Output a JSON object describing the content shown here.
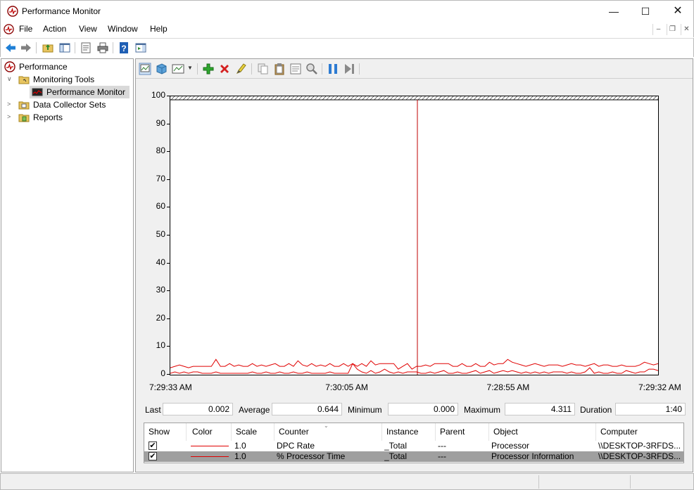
{
  "window": {
    "title": "Performance Monitor"
  },
  "menu": [
    "File",
    "Action",
    "View",
    "Window",
    "Help"
  ],
  "tree": {
    "items": [
      {
        "label": "Performance",
        "indent": 0,
        "icon": "perfmon-icon"
      },
      {
        "label": "Monitoring Tools",
        "indent": 1,
        "icon": "folder-icon"
      },
      {
        "label": "Performance Monitor",
        "indent": 2,
        "icon": "monitor-chart-icon"
      },
      {
        "label": "Data Collector Sets",
        "indent": 1,
        "icon": "folder-icon"
      },
      {
        "label": "Reports",
        "indent": 1,
        "icon": "folder-icon"
      }
    ]
  },
  "graph": {
    "x_labels": [
      "7:29:33 AM",
      "7:30:05 AM",
      "7:28:55 AM",
      "7:29:32 AM"
    ],
    "y_labels": [
      "100",
      "90",
      "80",
      "70",
      "60",
      "50",
      "40",
      "30",
      "20",
      "10",
      "0"
    ]
  },
  "stats": {
    "last_label": "Last",
    "last_value": "0.002",
    "avg_label": "Average",
    "avg_value": "0.644",
    "min_label": "Minimum",
    "min_value": "0.000",
    "max_label": "Maximum",
    "max_value": "4.311",
    "dur_label": "Duration",
    "dur_value": "1:40"
  },
  "counters": {
    "headers": [
      "Show",
      "Color",
      "Scale",
      "Counter",
      "Instance",
      "Parent",
      "Object",
      "Computer"
    ],
    "rows": [
      {
        "show": "✔",
        "scale": "1.0",
        "counter": "DPC Rate",
        "instance": "_Total",
        "parent": "---",
        "object": "Processor",
        "computer": "\\\\DESKTOP-3RFDS..."
      },
      {
        "show": "✔",
        "scale": "1.0",
        "counter": "% Processor Time",
        "instance": "_Total",
        "parent": "---",
        "object": "Processor Information",
        "computer": "\\\\DESKTOP-3RFDS..."
      }
    ]
  },
  "chart_data": {
    "type": "line",
    "ylim": [
      0,
      100
    ],
    "x_tick_labels": [
      "7:29:33 AM",
      "7:30:05 AM",
      "7:28:55 AM",
      "7:29:32 AM"
    ],
    "y_ticks": [
      100,
      90,
      80,
      70,
      60,
      50,
      40,
      30,
      20,
      10,
      0
    ],
    "grid": true,
    "series": [
      {
        "color": "#e00000",
        "values": [
          2.5,
          3,
          3.5,
          3,
          2.5,
          3,
          3,
          3,
          3,
          3,
          5.5,
          3,
          3,
          4,
          3,
          3.5,
          3,
          3,
          4,
          3,
          3.5,
          3,
          3.5,
          4,
          3,
          3,
          4,
          3,
          5,
          3.5,
          3,
          4,
          3,
          3.5,
          3,
          4,
          3,
          3,
          4,
          3,
          4,
          3,
          4,
          3,
          5,
          3.5,
          4,
          4,
          4,
          4,
          2,
          3,
          4,
          2,
          3,
          3,
          3.5,
          3,
          4,
          4,
          4,
          4,
          3,
          3,
          4,
          3,
          3,
          4,
          3,
          3,
          4.5,
          3.5,
          4,
          4,
          5.5,
          4.5,
          4,
          3.5,
          3,
          3.5,
          4,
          3.5,
          3,
          3.5,
          3.5,
          3.5,
          3,
          3.5,
          4,
          3.5,
          3.5,
          3,
          3.5,
          4,
          3,
          3.5,
          3.5,
          3,
          3,
          3.5,
          3,
          3,
          3,
          3.5,
          4.5,
          4,
          3.5,
          4
        ]
      },
      {
        "color": "#e00000",
        "values": [
          0.5,
          1,
          0.5,
          1,
          0.5,
          1,
          1,
          0.5,
          0.5,
          0.5,
          1,
          0.5,
          0.5,
          0.5,
          0.5,
          0.5,
          0.5,
          0.5,
          1,
          0.5,
          0.5,
          1,
          0.5,
          0.5,
          1,
          0.5,
          0.5,
          1,
          0.5,
          0.5,
          1,
          0.5,
          0.5,
          0.5,
          0.5,
          1,
          0.5,
          0.5,
          0.5,
          0.5,
          4,
          2,
          1,
          0.5,
          1.5,
          0.5,
          1,
          2,
          1,
          0.5,
          1,
          0.5,
          1,
          1,
          1,
          0.5,
          0.5,
          1,
          0.5,
          1,
          1.5,
          0.5,
          0.5,
          1,
          0.5,
          0.5,
          1,
          1.5,
          0.5,
          1,
          1.5,
          0.5,
          1,
          1.5,
          1,
          1.5,
          1,
          0.5,
          1,
          0.5,
          1,
          0.5,
          1,
          0.5,
          1,
          1,
          1,
          0.5,
          1,
          0.5,
          0.5,
          1,
          2.5,
          0.5,
          1,
          0.5,
          0.5,
          1,
          0.5,
          0.5,
          1.5,
          1,
          0.5,
          1,
          1,
          2,
          2,
          1.5
        ]
      }
    ]
  },
  "status": {
    "segments": [
      "",
      "",
      ""
    ]
  }
}
